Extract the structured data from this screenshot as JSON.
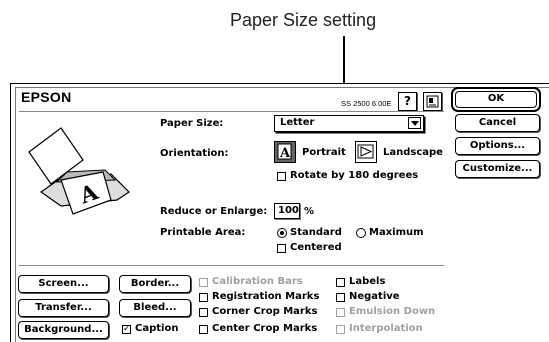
{
  "callout": {
    "text": "Paper Size setting"
  },
  "header": {
    "brand": "EPSON",
    "version": "SS 2500 6.00E",
    "help_glyph": "?"
  },
  "icons": {
    "printer": "printer-illustration-icon",
    "help": "help-icon",
    "info": "info-icon"
  },
  "paper_size": {
    "label": "Paper Size:",
    "value": "Letter"
  },
  "orientation": {
    "label": "Orientation:",
    "portrait": "Portrait",
    "landscape": "Landscape",
    "portrait_selected": true,
    "rotate_label": "Rotate by 180 degrees",
    "rotate_checked": false
  },
  "reduce": {
    "label": "Reduce or Enlarge:",
    "value": "100",
    "unit": "%"
  },
  "printable_area": {
    "label": "Printable Area:",
    "standard": "Standard",
    "maximum": "Maximum",
    "selected": "Standard",
    "centered_label": "Centered",
    "centered_checked": false
  },
  "side_buttons": {
    "ok": "OK",
    "cancel": "Cancel",
    "options": "Options...",
    "customize": "Customize..."
  },
  "bottom_buttons": {
    "screen": "Screen...",
    "border": "Border...",
    "transfer": "Transfer...",
    "bleed": "Bleed...",
    "background": "Background..."
  },
  "marks": {
    "caption": {
      "label": "Caption",
      "checked": true,
      "enabled": true
    },
    "calibration_bars": {
      "label": "Calibration Bars",
      "checked": false,
      "enabled": false
    },
    "registration_marks": {
      "label": "Registration Marks",
      "checked": false,
      "enabled": true
    },
    "corner_crop_marks": {
      "label": "Corner Crop Marks",
      "checked": false,
      "enabled": true
    },
    "center_crop_marks": {
      "label": "Center Crop Marks",
      "checked": false,
      "enabled": true
    },
    "labels": {
      "label": "Labels",
      "checked": false,
      "enabled": true
    },
    "negative": {
      "label": "Negative",
      "checked": false,
      "enabled": true
    },
    "emulsion_down": {
      "label": "Emulsion Down",
      "checked": false,
      "enabled": false
    },
    "interpolation": {
      "label": "Interpolation",
      "checked": false,
      "enabled": false
    }
  },
  "colors": {
    "dim_text": "#a0a0a0",
    "outline": "#000000"
  }
}
